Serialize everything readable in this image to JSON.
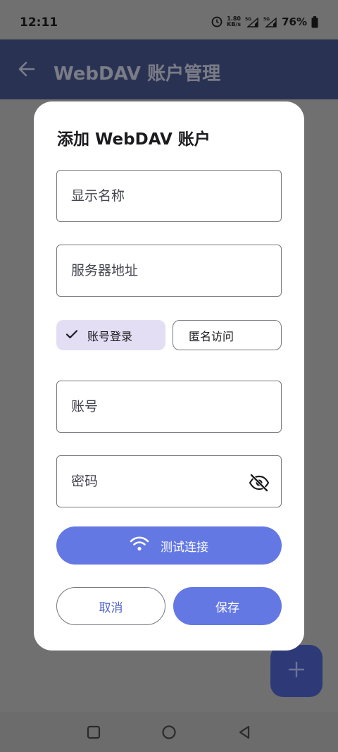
{
  "status_bar": {
    "time": "12:11",
    "net_speed_value": "1.80",
    "net_speed_unit": "KB/s",
    "battery_percent": "76%",
    "icons": [
      "alarm-icon",
      "signal-5g-icon",
      "signal-5g-icon",
      "battery-icon"
    ]
  },
  "app_bar": {
    "title": "WebDAV 账户管理",
    "back_icon": "arrow-left-icon"
  },
  "dialog": {
    "title": "添加 WebDAV 账户",
    "display_name_placeholder": "显示名称",
    "server_address_placeholder": "服务器地址",
    "login_modes": [
      {
        "label": "账号登录",
        "selected": true
      },
      {
        "label": "匿名访问",
        "selected": false
      }
    ],
    "account_placeholder": "账号",
    "password_placeholder": "密码",
    "test_connection_label": "测试连接",
    "cancel_label": "取消",
    "save_label": "保存"
  },
  "fab": {
    "icon": "plus-icon"
  },
  "nav_bar": {
    "icons": [
      "recents-square-icon",
      "home-circle-icon",
      "back-triangle-icon"
    ]
  },
  "colors": {
    "app_bar": "#2a3254",
    "scrim": "#707070",
    "primary": "#6478e4",
    "chip_selected": "#e4def5",
    "fab": "#2e3a78"
  }
}
